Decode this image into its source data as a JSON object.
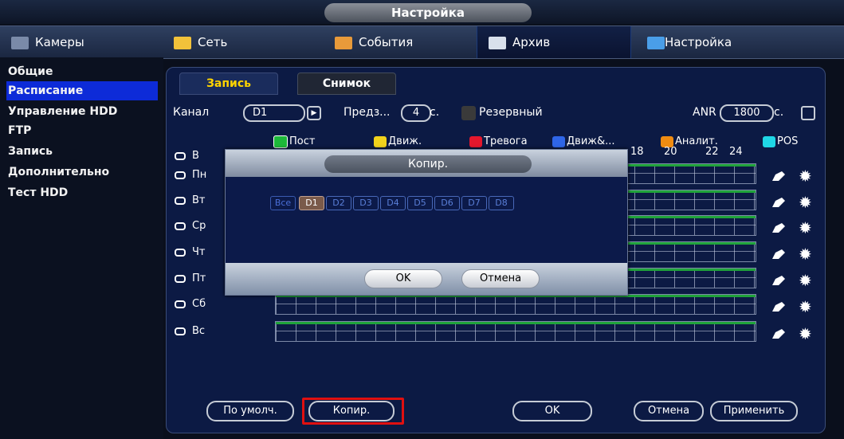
{
  "window": {
    "title": "Настройка"
  },
  "topnav": [
    {
      "label": "Камеры",
      "icon": "camera-icon"
    },
    {
      "label": "Сеть",
      "icon": "network-icon"
    },
    {
      "label": "События",
      "icon": "events-icon"
    },
    {
      "label": "Архив",
      "icon": "archive-icon"
    },
    {
      "label": "Настройка",
      "icon": "settings-icon"
    }
  ],
  "sidebar": {
    "items": [
      {
        "label": "Общие"
      },
      {
        "label": "Расписание"
      },
      {
        "label": "Управление HDD"
      },
      {
        "label": "FTP"
      },
      {
        "label": "Запись"
      },
      {
        "label": "Дополнительно"
      },
      {
        "label": "Тест HDD"
      }
    ]
  },
  "subtabs": [
    {
      "label": "Запись"
    },
    {
      "label": "Снимок"
    }
  ],
  "controls": {
    "channel_label": "Канал",
    "channel_value": "D1",
    "prerecord_label": "Предз...",
    "prerecord_value": "4",
    "prerecord_unit": "с.",
    "backup_label": "Резервный",
    "anr_label": "ANR",
    "anr_value": "1800",
    "anr_unit": "с."
  },
  "legend": [
    {
      "label": "Пост",
      "color": "#1db83a"
    },
    {
      "label": "Движ.",
      "color": "#f1d21c"
    },
    {
      "label": "Тревога",
      "color": "#e4172d"
    },
    {
      "label": "Движ&...",
      "color": "#2f66e8"
    },
    {
      "label": "Аналит.",
      "color": "#f08c12"
    },
    {
      "label": "POS",
      "color": "#1fd7e6"
    }
  ],
  "hours": [
    "18",
    "20",
    "22",
    "24"
  ],
  "days": [
    {
      "label": "В"
    },
    {
      "label": "Пн"
    },
    {
      "label": "Вт"
    },
    {
      "label": "Ср"
    },
    {
      "label": "Чт"
    },
    {
      "label": "Пт"
    },
    {
      "label": "Сб"
    },
    {
      "label": "Вс"
    }
  ],
  "buttons": {
    "default": "По умолч.",
    "copy": "Копир.",
    "ok": "OK",
    "cancel": "Отмена",
    "apply": "Применить"
  },
  "dialog": {
    "title": "Копир.",
    "channels": [
      "Все",
      "D1",
      "D2",
      "D3",
      "D4",
      "D5",
      "D6",
      "D7",
      "D8"
    ],
    "ok": "OK",
    "cancel": "Отмена"
  }
}
